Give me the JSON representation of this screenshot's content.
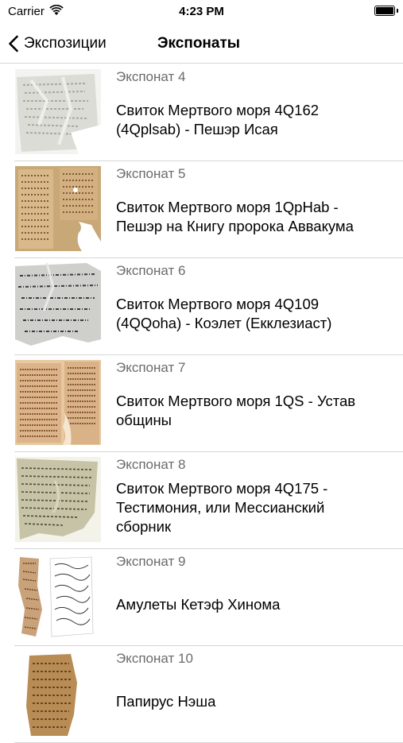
{
  "status_bar": {
    "carrier": "Carrier",
    "time": "4:23 PM"
  },
  "nav": {
    "back_label": "Экспозиции",
    "title": "Экспонаты"
  },
  "items": [
    {
      "subtitle": "Экспонат 4",
      "title": "Свиток Мертвого моря 4Q162 (4Qplsab) - Пешэр Исая"
    },
    {
      "subtitle": "Экспонат 5",
      "title": "Свиток Мертвого моря 1QpHab - Пешэр на Книгу пророка Аввакума"
    },
    {
      "subtitle": "Экспонат 6",
      "title": "Свиток Мертвого моря 4Q109 (4QQoha) - Коэлет (Екклезиаст)"
    },
    {
      "subtitle": "Экспонат 7",
      "title": "Свиток Мертвого моря 1QS - Устав общины"
    },
    {
      "subtitle": "Экспонат 8",
      "title": "Свиток Мертвого моря 4Q175 - Тестимония, или Мессианский сборник"
    },
    {
      "subtitle": "Экспонат 9",
      "title": "Амулеты Кетэф Хинома"
    },
    {
      "subtitle": "Экспонат 10",
      "title": "Папирус Нэша"
    }
  ]
}
